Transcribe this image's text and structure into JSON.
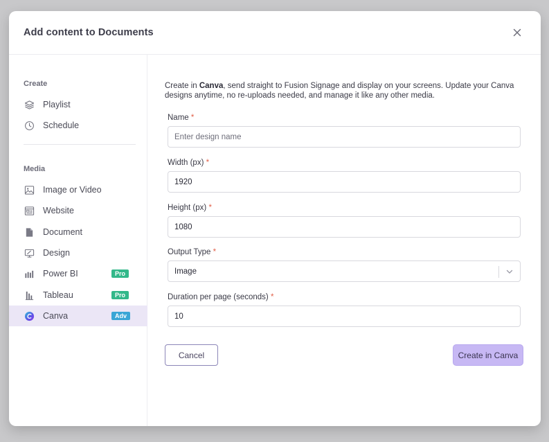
{
  "modal": {
    "title": "Add content to Documents",
    "close_icon": "close-icon"
  },
  "sidebar": {
    "create_label": "Create",
    "media_label": "Media",
    "create_items": [
      {
        "label": "Playlist",
        "icon": "layers-icon"
      },
      {
        "label": "Schedule",
        "icon": "clock-icon"
      }
    ],
    "media_items": [
      {
        "label": "Image or Video",
        "icon": "image-icon"
      },
      {
        "label": "Website",
        "icon": "website-icon"
      },
      {
        "label": "Document",
        "icon": "document-icon"
      },
      {
        "label": "Design",
        "icon": "design-icon"
      },
      {
        "label": "Power BI",
        "icon": "powerbi-icon",
        "badge": "Pro"
      },
      {
        "label": "Tableau",
        "icon": "tableau-icon",
        "badge": "Pro"
      },
      {
        "label": "Canva",
        "icon": "canva-icon",
        "badge": "Adv",
        "active": true
      }
    ]
  },
  "form": {
    "intro_prefix": "Create in ",
    "intro_bold": "Canva",
    "intro_suffix": ", send straight to Fusion Signage and display on your screens. Update your Canva designs anytime, no re-uploads needed, and manage it like any other media.",
    "name": {
      "label": "Name",
      "required": "*",
      "value": "",
      "placeholder": "Enter design name"
    },
    "width": {
      "label": "Width (px)",
      "required": "*",
      "value": "1920"
    },
    "height": {
      "label": "Height (px)",
      "required": "*",
      "value": "1080"
    },
    "output_type": {
      "label": "Output Type",
      "required": "*",
      "value": "Image"
    },
    "duration": {
      "label": "Duration per page (seconds)",
      "required": "*",
      "value": "10"
    }
  },
  "actions": {
    "cancel_label": "Cancel",
    "create_label": "Create in Canva"
  },
  "colors": {
    "accent": "#c7b8f4",
    "active_bg": "#ebe6f6",
    "required": "#e2614a",
    "badge_pro": "#33b88a",
    "badge_adv": "#3aa6d6"
  }
}
